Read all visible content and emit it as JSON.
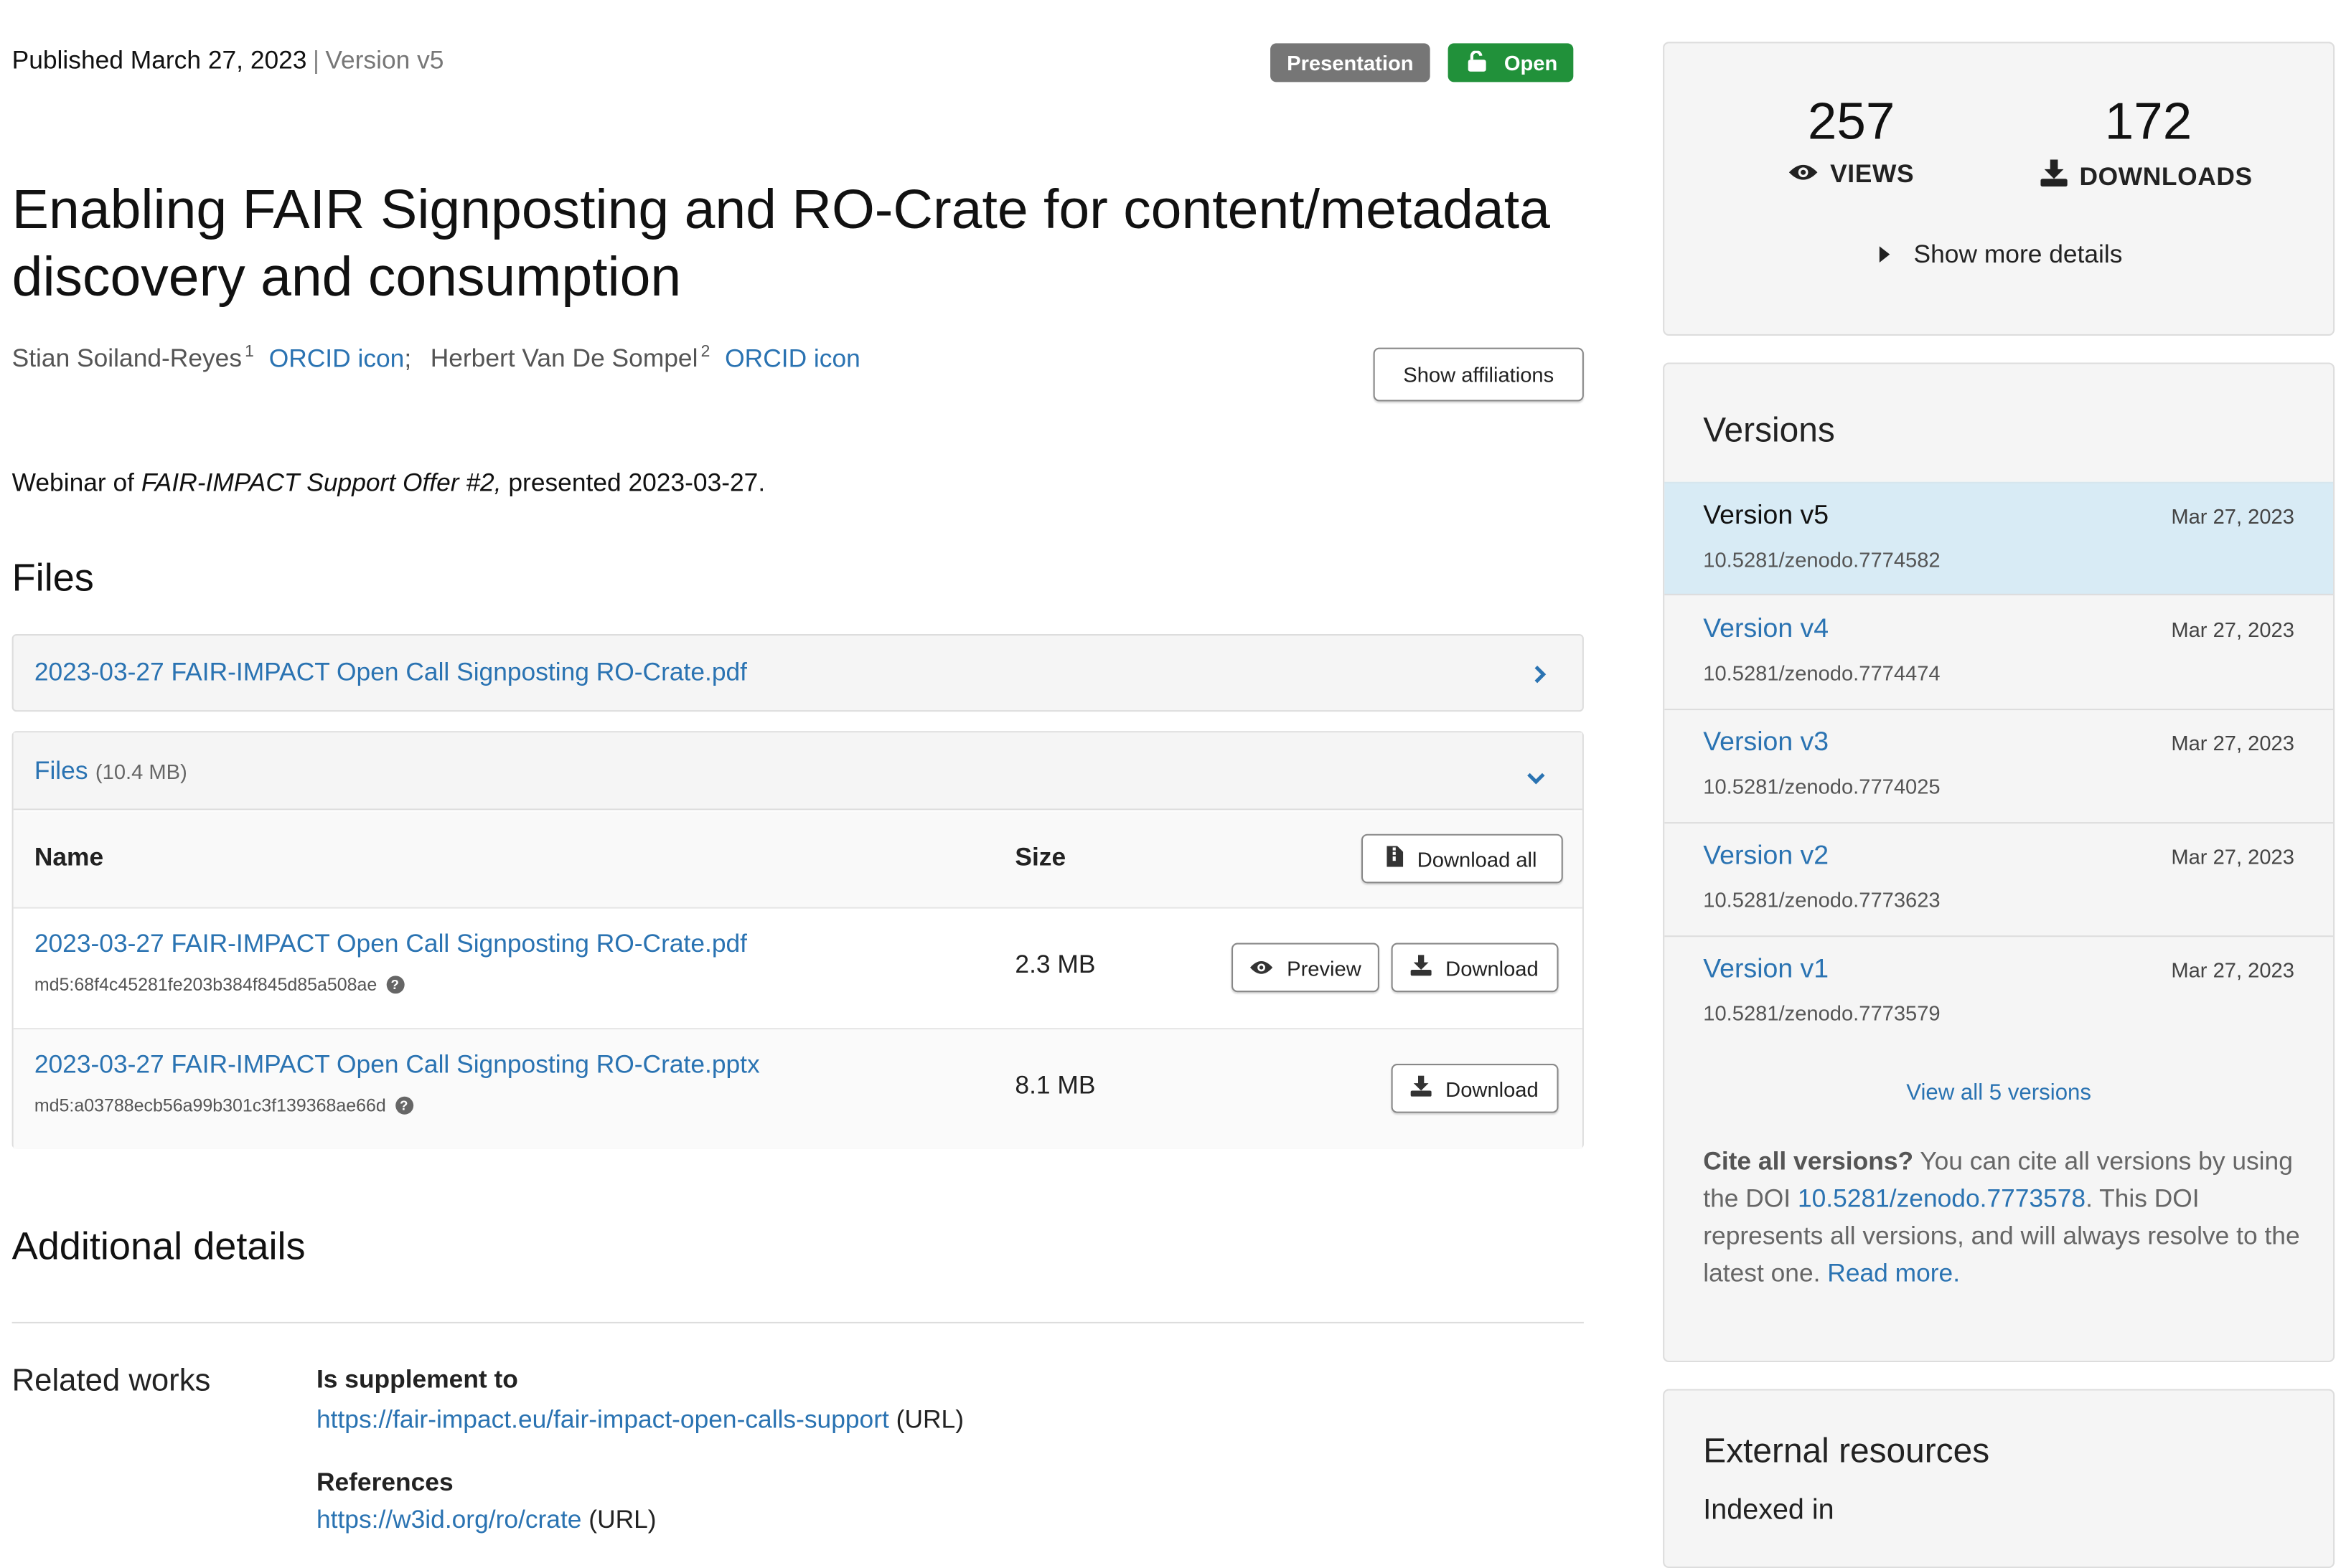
{
  "header": {
    "published": "Published March 27, 2023",
    "separator": "|",
    "version": "Version v5",
    "resource_type": "Presentation",
    "access": "Open"
  },
  "title": "Enabling FAIR Signposting and RO-Crate for content/metadata discovery and consumption",
  "creators": [
    {
      "name": "Stian Soiland-Reyes",
      "affiliation_ref": "1",
      "orcid_label": "ORCID icon",
      "sep": ";"
    },
    {
      "name": "Herbert Van De Sompel",
      "affiliation_ref": "2",
      "orcid_label": "ORCID icon"
    }
  ],
  "show_affiliations": "Show affiliations",
  "description": {
    "prefix": "Webinar of ",
    "emphasis": "FAIR-IMPACT Support Offer #2,",
    "suffix": " presented 2023-03-27."
  },
  "files": {
    "heading": "Files",
    "preview_file": "2023-03-27 FAIR-IMPACT Open Call Signposting RO-Crate.pdf",
    "panel_title": "Files",
    "panel_size": "(10.4 MB)",
    "col_name": "Name",
    "col_size": "Size",
    "download_all": "Download all",
    "preview_label": "Preview",
    "download_label": "Download",
    "items": [
      {
        "name": "2023-03-27 FAIR-IMPACT Open Call Signposting RO-Crate.pdf",
        "md5": "md5:68f4c45281fe203b384f845d85a508ae",
        "size": "2.3 MB"
      },
      {
        "name": "2023-03-27 FAIR-IMPACT Open Call Signposting RO-Crate.pptx",
        "md5": "md5:a03788ecb56a99b301c3f139368ae66d",
        "size": "8.1 MB"
      }
    ]
  },
  "additional": {
    "heading": "Additional details",
    "related_label": "Related works",
    "supplement_label": "Is supplement to",
    "supplement_url": "https://fair-impact.eu/fair-impact-open-calls-support",
    "supplement_type": "(URL)",
    "references_label": "References",
    "references_url": "https://w3id.org/ro/crate",
    "references_type": "(URL)"
  },
  "stats": {
    "views": "257",
    "views_label": "VIEWS",
    "downloads": "172",
    "downloads_label": "DOWNLOADS",
    "more": "Show more details"
  },
  "versions": {
    "title": "Versions",
    "items": [
      {
        "label": "Version v5",
        "date": "Mar 27, 2023",
        "doi": "10.5281/zenodo.7774582"
      },
      {
        "label": "Version v4",
        "date": "Mar 27, 2023",
        "doi": "10.5281/zenodo.7774474"
      },
      {
        "label": "Version v3",
        "date": "Mar 27, 2023",
        "doi": "10.5281/zenodo.7774025"
      },
      {
        "label": "Version v2",
        "date": "Mar 27, 2023",
        "doi": "10.5281/zenodo.7773623"
      },
      {
        "label": "Version v1",
        "date": "Mar 27, 2023",
        "doi": "10.5281/zenodo.7773579"
      }
    ],
    "view_all": "View all 5 versions",
    "cite_bold": "Cite all versions?",
    "cite_text1": " You can cite all versions by using the DOI ",
    "cite_doi": "10.5281/zenodo.7773578",
    "cite_text2": ". This DOI represents all versions, and will always resolve to the latest one. ",
    "read_more": "Read more."
  },
  "external": {
    "title": "External resources",
    "indexed": "Indexed in"
  },
  "colors": {
    "link": "#2a73b2",
    "badge_open": "#21913a",
    "badge_type": "#767676",
    "active_version_bg": "#d8ebf5"
  }
}
